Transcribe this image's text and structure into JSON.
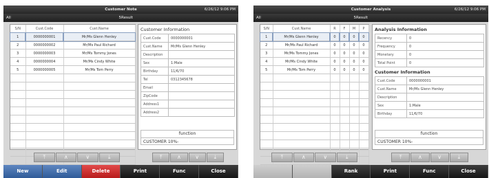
{
  "left": {
    "title": "Customer Note",
    "datetime": "6/26/12 9:06 PM",
    "filter_label": "All",
    "result_label": "5Result",
    "list_headers": [
      "S/N",
      "Cust.Code",
      "Cust.Name"
    ],
    "rows": [
      {
        "sn": "1",
        "code": "0000000001",
        "name": "Mr/Ms Glenn Henley"
      },
      {
        "sn": "2",
        "code": "0000000002",
        "name": "Mr/Ms Paul Richard"
      },
      {
        "sn": "3",
        "code": "0000000003",
        "name": "Mr/Ms Tommy Jones"
      },
      {
        "sn": "4",
        "code": "0000000004",
        "name": "Mr/Ms Cindy White"
      },
      {
        "sn": "5",
        "code": "0000000005",
        "name": "Mr/Ms Tom Perry"
      }
    ],
    "info_title": "Customer Information",
    "info_fields": [
      {
        "key": "Cust.Code",
        "value": "0000000001"
      },
      {
        "key": "Cust.Name",
        "value": "Mr/Ms Glenn Henley"
      },
      {
        "key": "Description",
        "value": ""
      },
      {
        "key": "Sex",
        "value": "1:Male"
      },
      {
        "key": "Birthday",
        "value": "11/6/70"
      },
      {
        "key": "Tel",
        "value": "0312345678"
      },
      {
        "key": "Email",
        "value": ""
      },
      {
        "key": "ZipCode",
        "value": ""
      },
      {
        "key": "Address1",
        "value": ""
      },
      {
        "key": "Address2",
        "value": ""
      }
    ],
    "function_label": "function",
    "function_value": "CUSTOMER 10%-",
    "buttons": {
      "new": "New",
      "edit": "Edit",
      "delete": "Delete",
      "print": "Print",
      "func": "Func",
      "close": "Close"
    }
  },
  "right": {
    "title": "Customer Analysis",
    "datetime": "6/26/12 9:06 PM",
    "filter_label": "All",
    "result_label": "5Result",
    "list_headers": [
      "S/N",
      "Cust.Name",
      "R",
      "F",
      "M",
      "P"
    ],
    "rows": [
      {
        "sn": "1",
        "name": "Mr/Ms Glenn Henley",
        "r": "0",
        "f": "0",
        "m": "0",
        "p": "0"
      },
      {
        "sn": "2",
        "name": "Mr/Ms Paul Richard",
        "r": "0",
        "f": "0",
        "m": "0",
        "p": "0"
      },
      {
        "sn": "3",
        "name": "Mr/Ms Tommy Jones",
        "r": "0",
        "f": "0",
        "m": "0",
        "p": "0"
      },
      {
        "sn": "4",
        "name": "Mr/Ms Cindy White",
        "r": "0",
        "f": "0",
        "m": "0",
        "p": "0"
      },
      {
        "sn": "5",
        "name": "Mr/Ms Tom Perry",
        "r": "0",
        "f": "0",
        "m": "0",
        "p": "0"
      }
    ],
    "analysis_title": "Analysis Information",
    "analysis_fields": [
      {
        "key": "Recency",
        "value": "0"
      },
      {
        "key": "Frequency",
        "value": "0"
      },
      {
        "key": "Monetary",
        "value": "0"
      },
      {
        "key": "Total Point",
        "value": "0"
      }
    ],
    "info_title": "Customer Information",
    "info_fields": [
      {
        "key": "Cust.Code",
        "value": "0000000001"
      },
      {
        "key": "Cust.Name",
        "value": "Mr/Ms Glenn Henley"
      },
      {
        "key": "Description",
        "value": ""
      },
      {
        "key": "Sex",
        "value": "1:Male"
      },
      {
        "key": "Birthday",
        "value": "11/6/70"
      }
    ],
    "function_label": "function",
    "function_value": "CUSTOMER 10%-",
    "buttons": {
      "rank": "Rank",
      "print": "Print",
      "func": "Func",
      "close": "Close"
    }
  },
  "nav_icons": [
    "first-page-icon",
    "page-up-icon",
    "page-down-icon",
    "last-page-icon"
  ]
}
